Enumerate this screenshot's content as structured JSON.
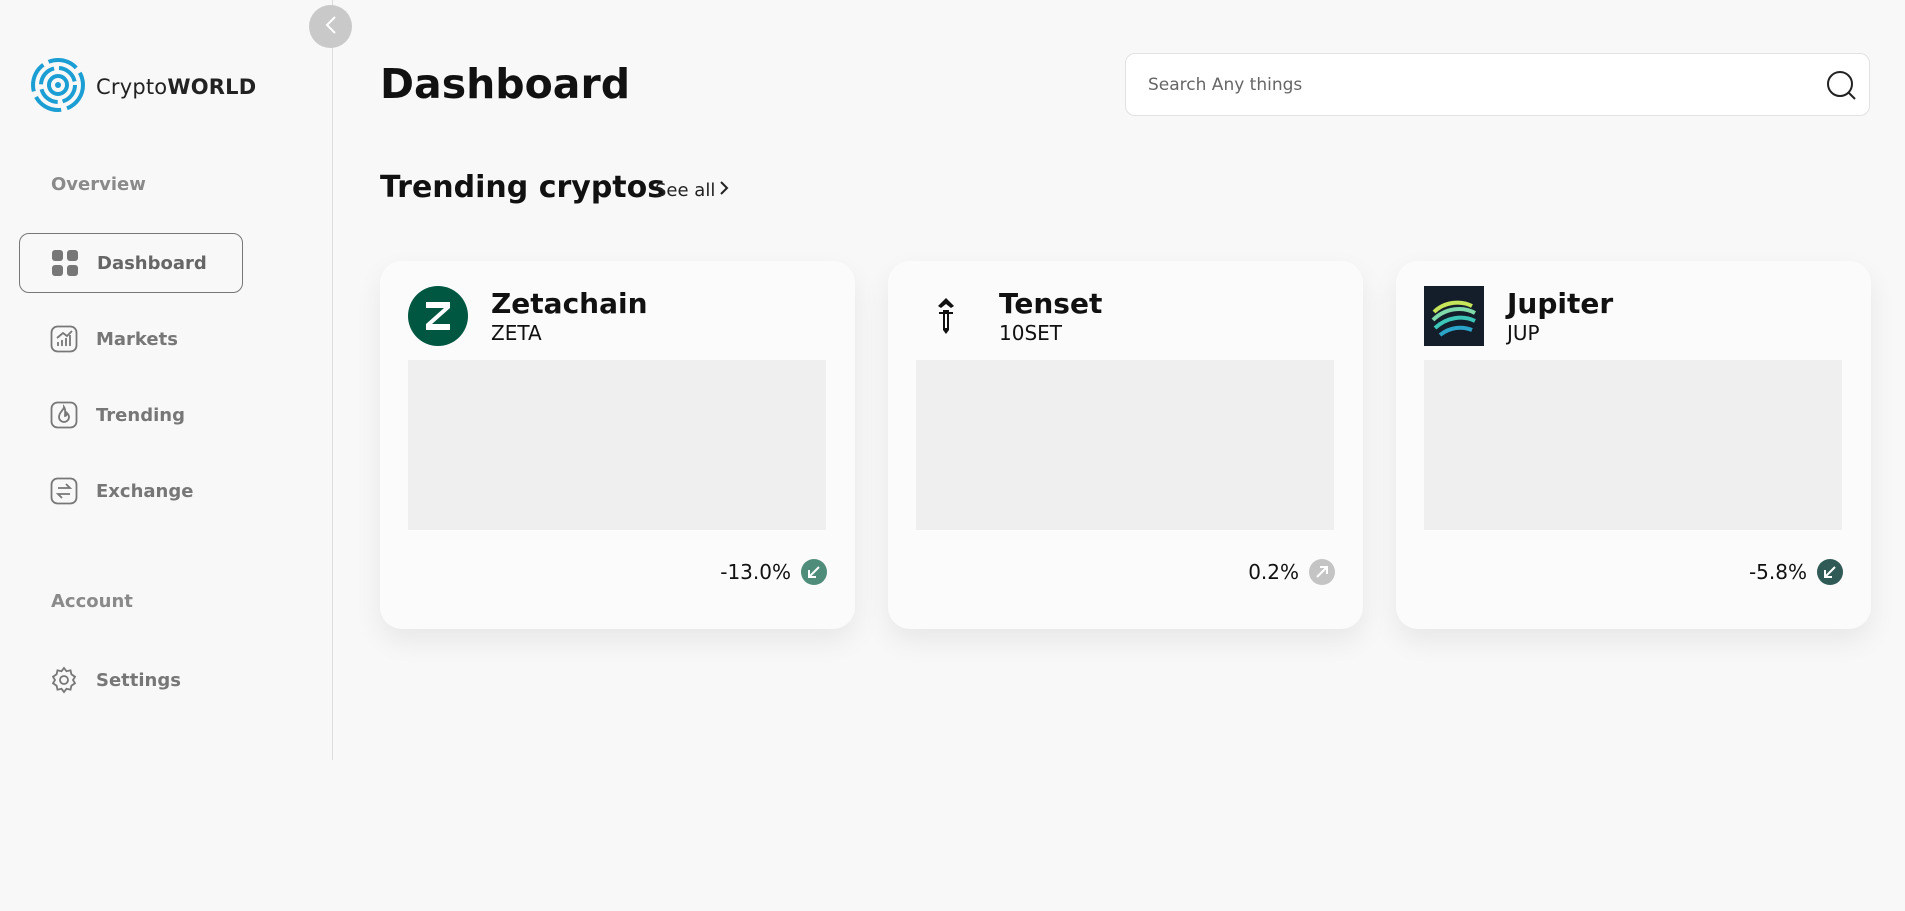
{
  "app": {
    "name_light": "Crypto",
    "name_bold": "WORLD"
  },
  "sidebar": {
    "overview_label": "Overview",
    "account_label": "Account",
    "items": [
      {
        "label": "Dashboard",
        "icon": "grid-icon",
        "active": true
      },
      {
        "label": "Markets",
        "icon": "chart-icon",
        "active": false
      },
      {
        "label": "Trending",
        "icon": "flame-icon",
        "active": false
      },
      {
        "label": "Exchange",
        "icon": "exchange-icon",
        "active": false
      }
    ],
    "account_items": [
      {
        "label": "Settings",
        "icon": "gear-icon"
      }
    ]
  },
  "header": {
    "title": "Dashboard",
    "search_placeholder": "Search Any things"
  },
  "trending": {
    "title": "Trending cryptos",
    "see_all": "See all",
    "cards": [
      {
        "name": "Zetachain",
        "symbol": "ZETA",
        "change": "-13.0%",
        "direction": "down",
        "badge_color": "#4f8c79",
        "logo_color": "#005741"
      },
      {
        "name": "Tenset",
        "symbol": "10SET",
        "change": "0.2%",
        "direction": "up",
        "badge_color": "#c4c4c4",
        "logo_color": "#111111"
      },
      {
        "name": "Jupiter",
        "symbol": "JUP",
        "change": "-5.8%",
        "direction": "down",
        "badge_color": "#2f5a55",
        "logo_color": "#141e2b"
      }
    ]
  },
  "colors": {
    "background": "#f8f8f8",
    "card": "#fbfbfb",
    "logo_blue": "#1a9ed3"
  }
}
